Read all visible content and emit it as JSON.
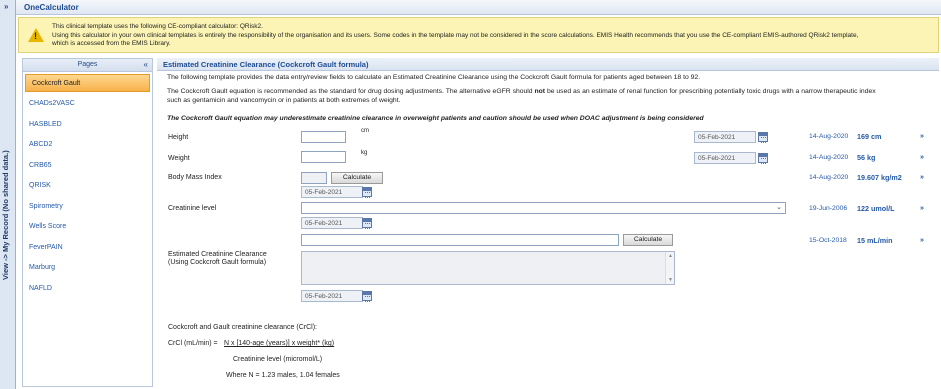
{
  "left_strip": {
    "expand_label": "»",
    "vertical_label": "View -> My Record (No shared data.)"
  },
  "app": {
    "title": "OneCalculator"
  },
  "warning": {
    "line1": "This clinical template uses the following CE-compliant calculator: QRisk2.",
    "line2": "Using this calculator in your own clinical templates is entirely the responsibility of the organisation and its users. Some codes in the template may not be considered in the score calculations. EMIS Health recommends that you use the CE-compliant EMIS-authored QRisk2 template,",
    "line3": "which is accessed from the EMIS Library."
  },
  "pages": {
    "header": "Pages",
    "collapse": "«",
    "items": [
      "Cockcroft Gault",
      "CHADs2VASC",
      "HASBLED",
      "ABCD2",
      "CRB65",
      "QRISK",
      "Spirometry",
      "Wells Score",
      "FeverPAIN",
      "Marburg",
      "NAFLD"
    ]
  },
  "main": {
    "title": "Estimated Creatinine Clearance (Cockcroft Gault formula)",
    "intro": "The following template provides the data entry/review fields to calculate an Estimated Creatinine Clearance using the Cockcroft Gault formula for patients aged between 18 to 92.",
    "rec_a": "The Cockcroft Gault equation is recommended as the standard for drug dosing adjustments. The alternative eGFR should ",
    "rec_not": "not",
    "rec_b": " be used as an estimate of renal function for prescribing potentially toxic drugs with a narrow therapeutic index",
    "rec_c": "such as gentamicin and vancomycin or in patients at both extremes of weight.",
    "caution": "The Cockcroft Gault equation may underestimate creatinine clearance in overweight patients and caution should be used when DOAC adjustment is being considered",
    "height_label": "Height",
    "height_unit": "cm",
    "height_date": "05-Feb-2021",
    "height_prev_date": "14-Aug-2020",
    "height_prev_value": "169 cm",
    "weight_label": "Weight",
    "weight_unit": "kg",
    "weight_date": "05-Feb-2021",
    "weight_prev_date": "14-Aug-2020",
    "weight_prev_value": "56 kg",
    "bmi_label": "Body Mass Index",
    "bmi_button": "Calculate",
    "bmi_date": "05-Feb-2021",
    "bmi_prev_date": "14-Aug-2020",
    "bmi_prev_value": "19.607 kg/m2",
    "creat_label": "Creatinine level",
    "creat_date": "05-Feb-2021",
    "creat_prev_date": "19-Jun-2006",
    "creat_prev_value": "122 umol/L",
    "crcl_button": "Calculate",
    "crcl_prev_date": "15-Oct-2018",
    "crcl_prev_value": "15 mL/min",
    "ecc_label1": "Estimated Creatinine Clearance",
    "ecc_label2": "(Using Cockcroft Gault formula)",
    "ecc_date": "05-Feb-2021",
    "formula_title": "Cockcroft and Gault creatinine clearance (CrCl):",
    "formula_lhs": "CrCl (mL/min) =",
    "formula_num": "N x [140-age (years)] x weight* (kg)",
    "formula_den": "Creatinine level (micromol/L)",
    "formula_where": "Where N = 1.23 males, 1.04 females",
    "go": "»"
  }
}
